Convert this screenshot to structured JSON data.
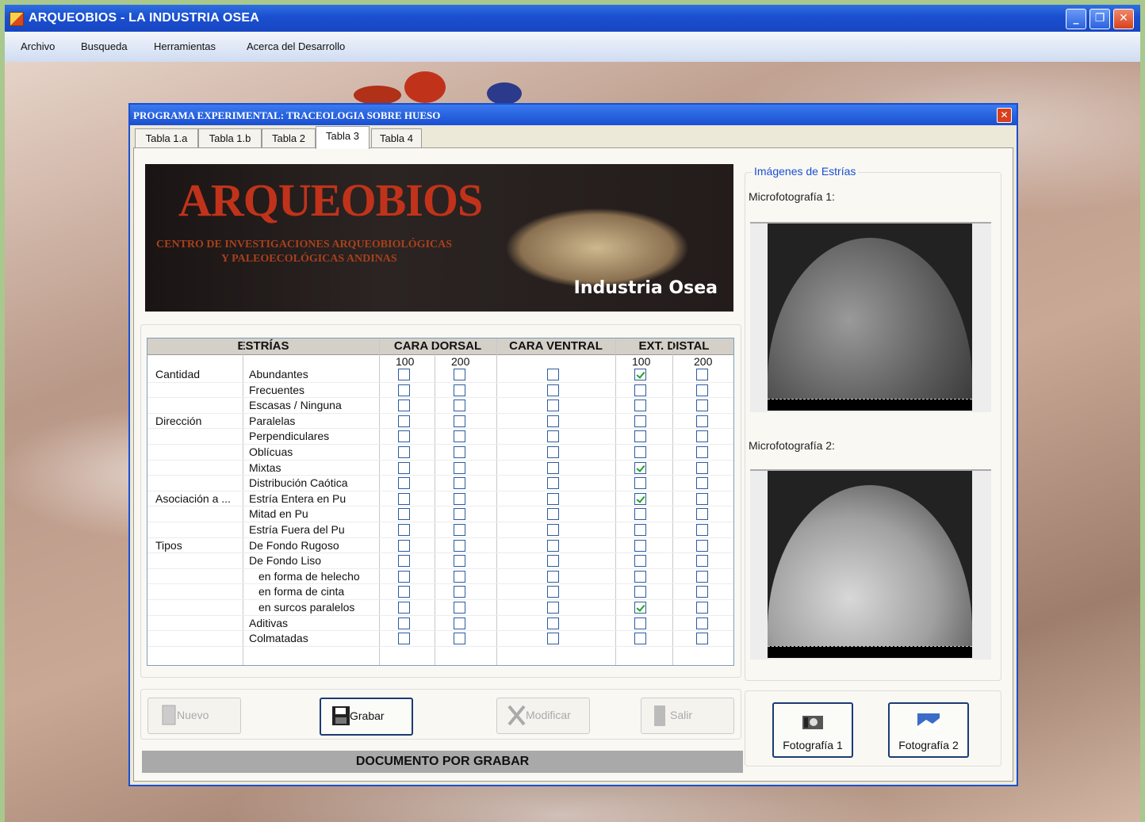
{
  "app": {
    "title": "ARQUEOBIOS - LA INDUSTRIA OSEA",
    "min_glyph": "_",
    "max_glyph": "❐",
    "close_glyph": "✕"
  },
  "menu": [
    "Archivo",
    "Busqueda",
    "Herramientas",
    "Acerca del Desarrollo"
  ],
  "dialog": {
    "title": "PROGRAMA EXPERIMENTAL: TRACEOLOGIA SOBRE HUESO",
    "close_glyph": "✕",
    "tabs": [
      "Tabla 1.a",
      "Tabla 1.b",
      "Tabla 2",
      "Tabla 3",
      "Tabla 4"
    ],
    "active_tab": "Tabla 3"
  },
  "banner": {
    "title": "ARQUEOBIOS",
    "subtitle_1": "CENTRO DE INVESTIGACIONES ARQUEOBIOLÓGICAS",
    "subtitle_2": "Y PALEOECOLÓGICAS ANDINAS",
    "caption": "Industria Osea"
  },
  "grid": {
    "headers": [
      "ESTRÍAS",
      "CARA DORSAL",
      "CARA VENTRAL",
      "EXT. DISTAL"
    ],
    "subheaders": {
      "dorsal_100": "100",
      "dorsal_200": "200",
      "distal_100": "100",
      "distal_200": "200"
    },
    "rows": [
      {
        "group": "Cantidad",
        "label": "Abundantes",
        "checks": [
          false,
          false,
          false,
          true,
          false
        ]
      },
      {
        "group": "",
        "label": "Frecuentes",
        "checks": [
          false,
          false,
          false,
          false,
          false
        ]
      },
      {
        "group": "",
        "label": "Escasas / Ninguna",
        "checks": [
          false,
          false,
          false,
          false,
          false
        ]
      },
      {
        "group": "Dirección",
        "label": "Paralelas",
        "checks": [
          false,
          false,
          false,
          false,
          false
        ]
      },
      {
        "group": "",
        "label": "Perpendiculares",
        "checks": [
          false,
          false,
          false,
          false,
          false
        ]
      },
      {
        "group": "",
        "label": "Oblícuas",
        "checks": [
          false,
          false,
          false,
          false,
          false
        ]
      },
      {
        "group": "",
        "label": "Mixtas",
        "checks": [
          false,
          false,
          false,
          true,
          false
        ]
      },
      {
        "group": "",
        "label": "Distribución Caótica",
        "checks": [
          false,
          false,
          false,
          false,
          false
        ]
      },
      {
        "group": "Asociación a ...",
        "label": "Estría Entera en Pu",
        "checks": [
          false,
          false,
          false,
          true,
          false
        ]
      },
      {
        "group": "",
        "label": "Mitad en Pu",
        "checks": [
          false,
          false,
          false,
          false,
          false
        ]
      },
      {
        "group": "",
        "label": "Estría Fuera del Pu",
        "checks": [
          false,
          false,
          false,
          false,
          false
        ]
      },
      {
        "group": "Tipos",
        "label": "De Fondo Rugoso",
        "checks": [
          false,
          false,
          false,
          false,
          false
        ]
      },
      {
        "group": "",
        "label": "De Fondo Liso",
        "checks": [
          false,
          false,
          false,
          false,
          false
        ]
      },
      {
        "group": "",
        "label": "en forma de helecho",
        "checks": [
          false,
          false,
          false,
          false,
          false
        ]
      },
      {
        "group": "",
        "label": "en forma de cinta",
        "checks": [
          false,
          false,
          false,
          false,
          false
        ]
      },
      {
        "group": "",
        "label": "en surcos paralelos",
        "checks": [
          false,
          false,
          false,
          true,
          false
        ]
      },
      {
        "group": "",
        "label": "Aditivas",
        "checks": [
          false,
          false,
          false,
          false,
          false
        ]
      },
      {
        "group": "",
        "label": "Colmatadas",
        "checks": [
          false,
          false,
          false,
          false,
          false
        ]
      }
    ]
  },
  "buttons": {
    "nuevo": "Nuevo",
    "grabar": "Grabar",
    "modificar": "Modificar",
    "salir": "Salir"
  },
  "status": "DOCUMENTO POR GRABAR",
  "images": {
    "group_label": "Imágenes de Estrías",
    "micro_1": "Microfotografía 1:",
    "micro_2": "Microfotografía 2:",
    "foto_1": "Fotografía 1",
    "foto_2": "Fotografía 2"
  },
  "icons": [
    "app-icon",
    "save-disk-icon",
    "new-doc-icon",
    "tools-icon",
    "exit-door-icon",
    "camera-icon",
    "landscape-picture-icon"
  ],
  "colors": {
    "titlebar": "#1a4fd0",
    "check": "#21a121",
    "status_bg": "#a9a9a9"
  }
}
